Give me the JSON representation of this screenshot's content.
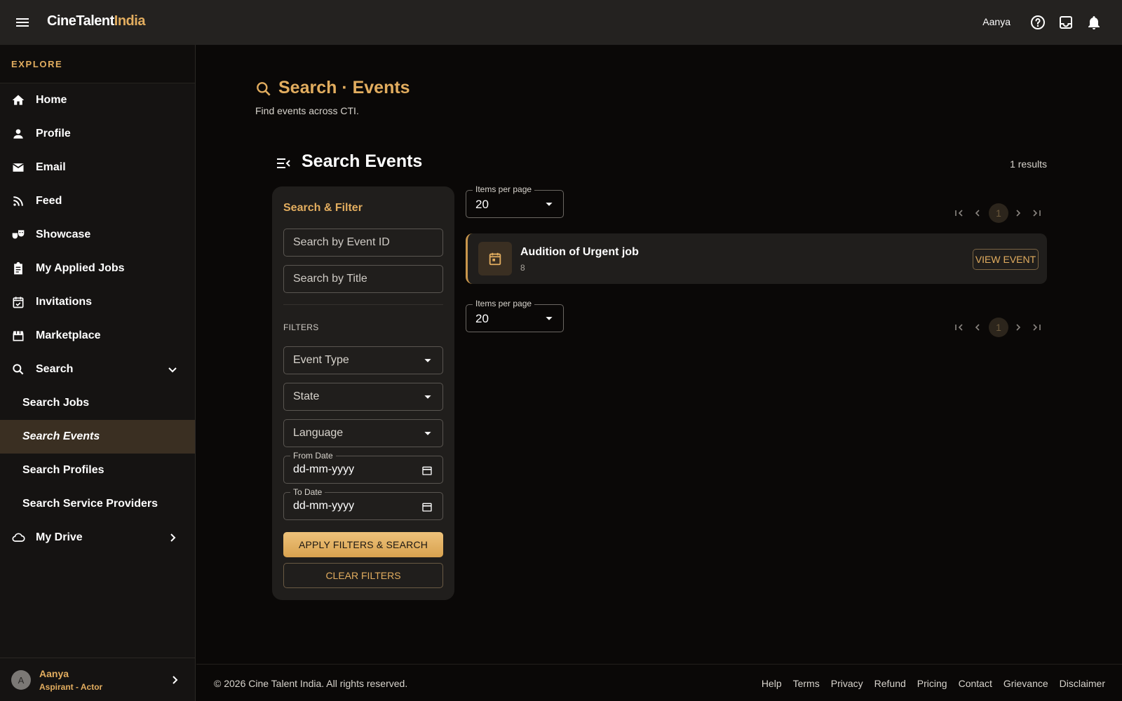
{
  "app": {
    "logo_main": "CineTalent",
    "logo_accent": "India",
    "user_name": "Aanya"
  },
  "colors": {
    "accent": "#e2ad5f",
    "background": "#0a0807",
    "topbar": "#242220",
    "sidebar": "#151312",
    "panel": "#201e1c",
    "active_nav": "#3a2f22"
  },
  "topbar": {
    "icons": [
      "menu-icon",
      "help-icon",
      "inbox-icon",
      "bell-icon"
    ]
  },
  "sidebar": {
    "section_label": "EXPLORE",
    "items": [
      {
        "label": "Home",
        "icon": "home-icon"
      },
      {
        "label": "Profile",
        "icon": "person-icon"
      },
      {
        "label": "Email",
        "icon": "mail-icon"
      },
      {
        "label": "Feed",
        "icon": "rss-icon"
      },
      {
        "label": "Showcase",
        "icon": "theater-masks-icon"
      },
      {
        "label": "My Applied Jobs",
        "icon": "clipboard-icon"
      },
      {
        "label": "Invitations",
        "icon": "event-available-icon"
      },
      {
        "label": "Marketplace",
        "icon": "storefront-icon"
      },
      {
        "label": "Search",
        "icon": "search-icon",
        "expanded": true
      },
      {
        "label": "My Drive",
        "icon": "cloud-icon"
      }
    ],
    "search_children": [
      {
        "label": "Search Jobs"
      },
      {
        "label": "Search Events",
        "active": true
      },
      {
        "label": "Search Profiles"
      },
      {
        "label": "Search Service Providers"
      }
    ],
    "user": {
      "avatar_letter": "A",
      "name": "Aanya",
      "role": "Aspirant - Actor"
    }
  },
  "page": {
    "title": "Search · Events",
    "subtitle": "Find events across CTI."
  },
  "section": {
    "title": "Search Events",
    "results_text": "1 results"
  },
  "filter_panel": {
    "title": "Search & Filter",
    "event_id_placeholder": "Search by Event ID",
    "event_id_value": "",
    "title_placeholder": "Search by Title",
    "title_value": "",
    "filters_label": "FILTERS",
    "event_type_label": "Event Type",
    "state_label": "State",
    "language_label": "Language",
    "from_date_label": "From Date",
    "from_date_value": "dd-mm-yyyy",
    "to_date_label": "To Date",
    "to_date_value": "dd-mm-yyyy",
    "apply_label": "APPLY FILTERS & SEARCH",
    "clear_label": "CLEAR FILTERS"
  },
  "pagination": {
    "items_per_page_label": "Items per page",
    "items_per_page_value": "20",
    "current_page": "1"
  },
  "events": [
    {
      "title": "Audition of Urgent job",
      "subtitle": "8",
      "icon": "calendar-icon",
      "action_label": "VIEW EVENT"
    }
  ],
  "footer": {
    "copyright": "© 2026 Cine Talent India. All rights reserved.",
    "links": [
      "Help",
      "Terms",
      "Privacy",
      "Refund",
      "Pricing",
      "Contact",
      "Grievance",
      "Disclaimer"
    ]
  }
}
